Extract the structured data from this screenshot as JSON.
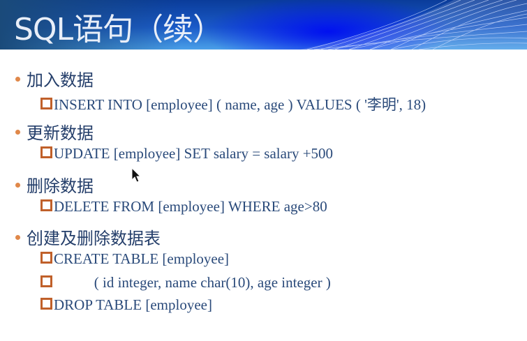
{
  "slide": {
    "title": "SQL语句（续）",
    "accent_color": "#e0884a",
    "text_color": "#2a4a7a",
    "sections": [
      {
        "heading": "加入数据",
        "items": [
          "INSERT INTO [employee] ( name, age ) VALUES ( '李明', 18)"
        ]
      },
      {
        "heading": "更新数据",
        "items": [
          "UPDATE [employee] SET salary = salary +500"
        ]
      },
      {
        "heading": "删除数据",
        "items": [
          "DELETE FROM [employee] WHERE age>80"
        ]
      },
      {
        "heading": "创建及删除数据表",
        "items": [
          "CREATE TABLE [employee]",
          "           ( id integer, name char(10), age integer )",
          "DROP TABLE [employee]"
        ]
      }
    ]
  },
  "cursor": {
    "icon": "mouse-pointer-icon"
  }
}
